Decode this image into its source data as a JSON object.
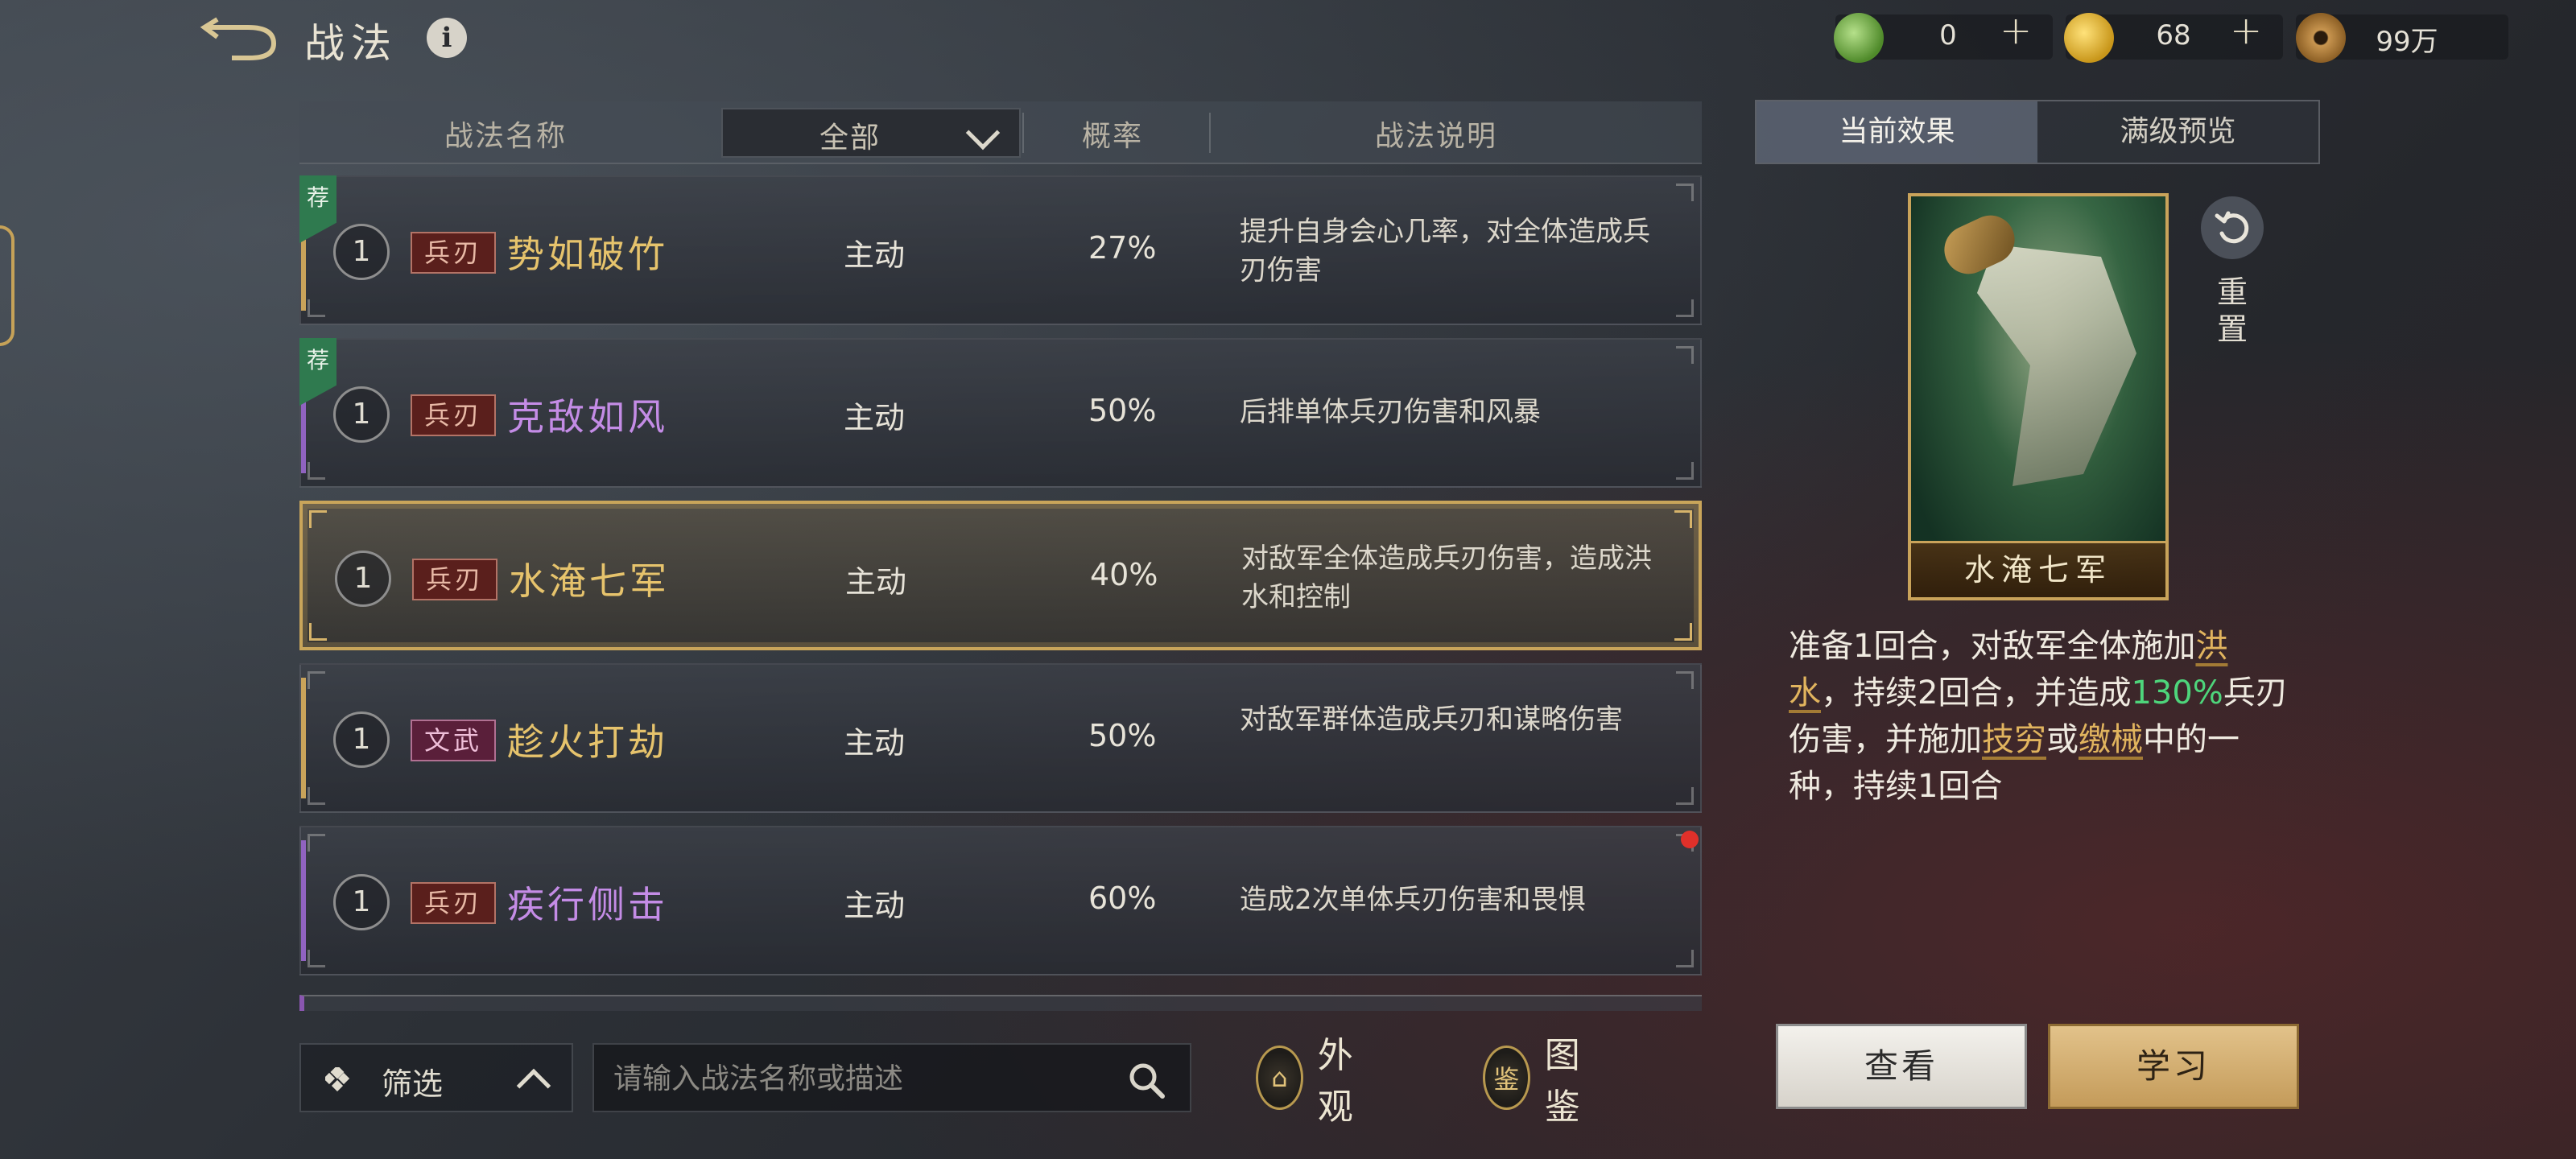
{
  "header": {
    "title": "战法",
    "resources": [
      {
        "icon": "jade-coin-icon",
        "value": "0",
        "color": "#6aa84f"
      },
      {
        "icon": "gold-coin-icon",
        "value": "68",
        "color": "#e6b422"
      },
      {
        "icon": "copper-coin-icon",
        "value": "99万",
        "color": "#b07a3a"
      }
    ]
  },
  "list": {
    "columns": {
      "name": "战法名称",
      "filter_selected": "全部",
      "rate": "概率",
      "desc": "战法说明"
    },
    "rows": [
      {
        "recommended": "荐",
        "level": "1",
        "tag": "兵刃",
        "name": "势如破竹",
        "type": "主动",
        "rate": "27%",
        "desc": "提升自身会心几率，对全体造成兵刃伤害",
        "name_color": "#e6c36c",
        "edge_color": "#c9a35a"
      },
      {
        "recommended": "荐",
        "level": "1",
        "tag": "兵刃",
        "name": "克敌如风",
        "type": "主动",
        "rate": "50%",
        "desc": "后排单体兵刃伤害和风暴",
        "name_color": "#c48ce6",
        "edge_color": "#9063c0"
      },
      {
        "recommended": "",
        "level": "1",
        "tag": "兵刃",
        "name": "水淹七军",
        "type": "主动",
        "rate": "40%",
        "desc": "对敌军全体造成兵刃伤害，造成洪水和控制",
        "name_color": "#e6c36c",
        "edge_color": "#c9a35a"
      },
      {
        "recommended": "",
        "level": "1",
        "tag": "文武",
        "name": "趁火打劫",
        "type": "主动",
        "rate": "50%",
        "desc": "对敌军群体造成兵刃和谋略伤害",
        "name_color": "#e6c36c",
        "edge_color": "#c9a35a"
      },
      {
        "recommended": "",
        "level": "1",
        "tag": "兵刃",
        "name": "疾行侧击",
        "type": "主动",
        "rate": "60%",
        "desc": "造成2次单体兵刃伤害和畏惧",
        "name_color": "#c48ce6",
        "edge_color": "#9063c0"
      }
    ]
  },
  "bottom": {
    "filter_label": "筛选",
    "search_placeholder": "请输入战法名称或描述",
    "appearance_label": "外观",
    "appearance_glyph": "⌂",
    "codex_label": "图鉴",
    "codex_glyph": "鉴"
  },
  "detail": {
    "tab_current": "当前效果",
    "tab_max": "满级预览",
    "card_name": "水淹七军",
    "reset_label": "重置",
    "effect": {
      "p1": "准备1回合，对敌军全体施加",
      "k1": "洪水",
      "p2": "，持续2回合，并造成",
      "pct": "130%",
      "p3": "兵刃伤害，并施加",
      "k2": "技穷",
      "p4": "或",
      "k3": "缴械",
      "p5": "中的一种，持续1回合"
    },
    "view_button": "查看",
    "learn_button": "学习"
  }
}
